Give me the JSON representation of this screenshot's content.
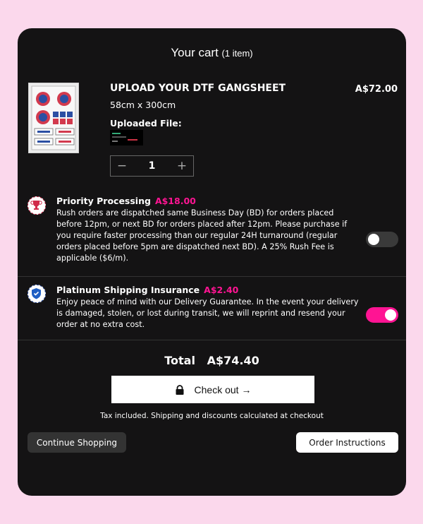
{
  "cart": {
    "title": "Your cart",
    "count": "(1 item)"
  },
  "product": {
    "name": "UPLOAD YOUR DTF GANGSHEET",
    "price": "A$72.00",
    "size": "58cm x 300cm",
    "uploaded_label": "Uploaded File:",
    "quantity": "1",
    "qty_minus": "−",
    "qty_plus": "+"
  },
  "addons": [
    {
      "title": "Priority Processing",
      "price": "A$18.00",
      "desc": "Rush orders are dispatched same Business Day (BD) for orders placed before 12pm, or next BD for orders placed after 12pm. Please purchase if you require faster processing than our regular 24H turnaround (regular orders placed before 5pm are dispatched next BD). A 25% Rush Fee is applicable ($6/m).",
      "enabled": false,
      "icon": "trophy-icon"
    },
    {
      "title": "Platinum Shipping Insurance",
      "price": "A$2.40",
      "desc": "Enjoy peace of mind with our Delivery Guarantee. In the event your delivery is damaged, stolen, or lost during transit, we will reprint and resend your order at no extra cost.",
      "enabled": true,
      "icon": "shield-check-icon"
    }
  ],
  "summary": {
    "total_label": "Total",
    "total_value": "A$74.40",
    "checkout_label": "Check out →",
    "tax_note": "Tax included. Shipping and discounts calculated at checkout",
    "continue_label": "Continue Shopping",
    "instructions_label": "Order Instructions"
  },
  "colors": {
    "accent": "#ff1493",
    "panel": "#141314",
    "page_bg": "#fbd8ec"
  }
}
